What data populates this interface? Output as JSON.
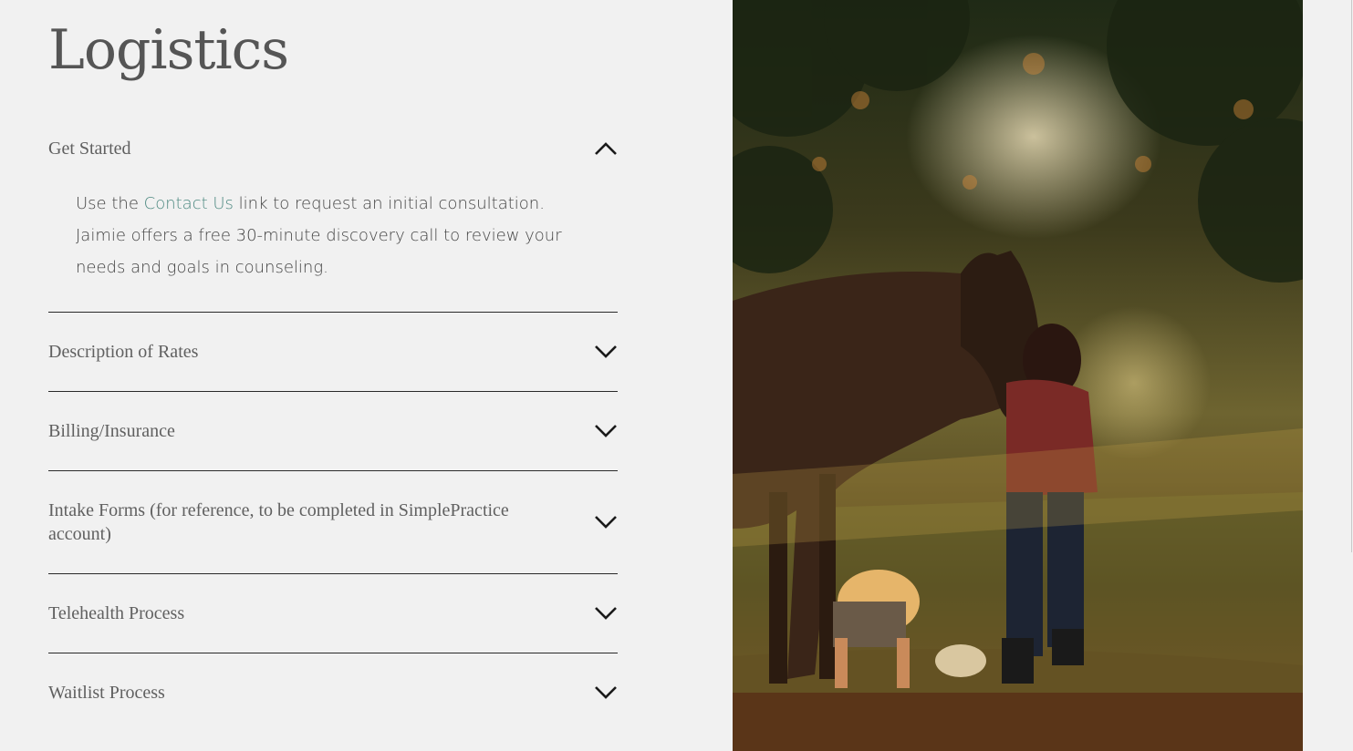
{
  "page": {
    "title": "Logistics"
  },
  "accordion": {
    "items": [
      {
        "label": "Get Started",
        "expanded": true,
        "icon": "chevron-up-icon"
      },
      {
        "label": "Description of Rates",
        "expanded": false,
        "icon": "chevron-down-icon"
      },
      {
        "label": "Billing/Insurance",
        "expanded": false,
        "icon": "chevron-down-icon"
      },
      {
        "label": "Intake Forms (for reference, to be completed in SimplePractice account)",
        "expanded": false,
        "icon": "chevron-down-icon"
      },
      {
        "label": "Telehealth Process",
        "expanded": false,
        "icon": "chevron-down-icon"
      },
      {
        "label": "Waitlist Process",
        "expanded": false,
        "icon": "chevron-down-icon"
      }
    ],
    "get_started_body": {
      "before_link": "Use the ",
      "link_text": "Contact Us",
      "after_link": " link to request an initial consultation. Jaimie offers a free 30-minute discovery call to review your needs and goals in counseling."
    }
  },
  "colors": {
    "background": "#f1f1f1",
    "link": "#4f8a82",
    "text": "#606060",
    "divider": "#2a2a2a"
  }
}
